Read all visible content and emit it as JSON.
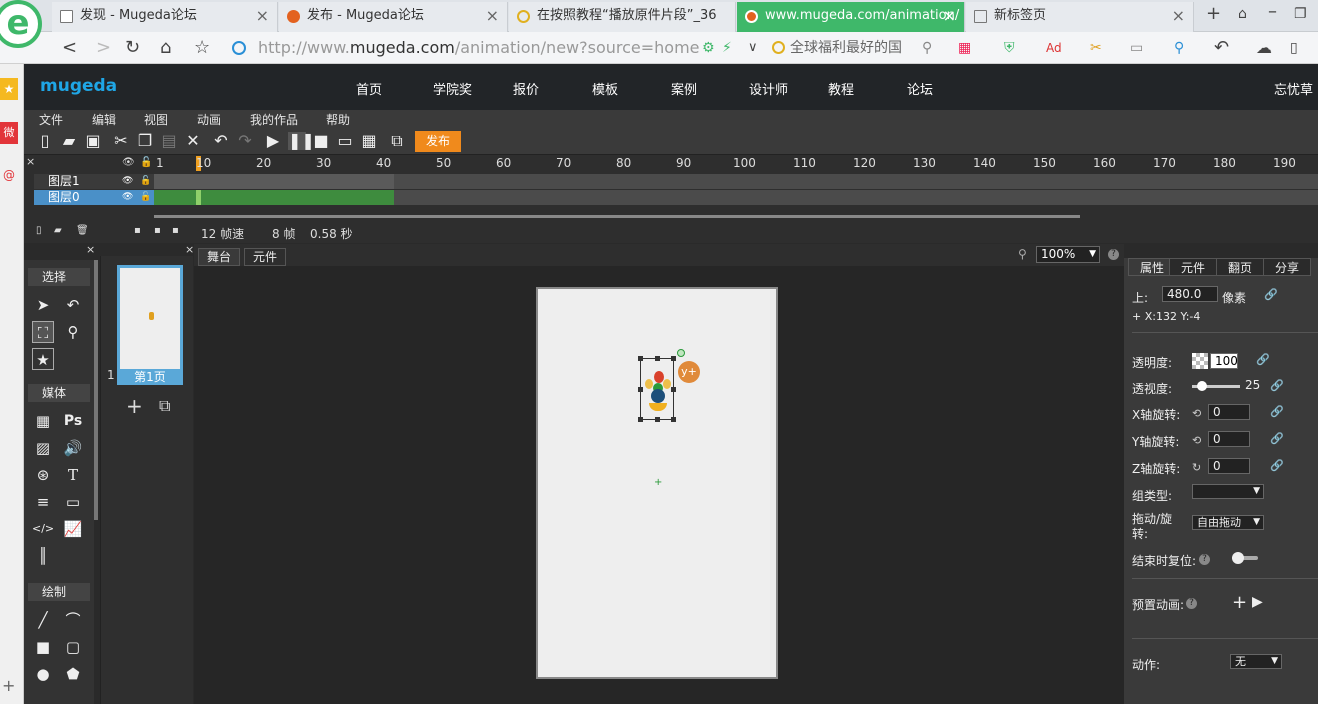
{
  "browser": {
    "tabs": [
      {
        "label": "发现 - Mugeda论坛",
        "active": false,
        "favicon_color": "#ffffff"
      },
      {
        "label": "发布 - Mugeda论坛",
        "active": false,
        "favicon_color": "#e3621f"
      },
      {
        "label": "在按照教程“播放原件片段”_36",
        "active": false,
        "favicon_color": "#e0b020"
      },
      {
        "label": "www.mugeda.com/animation/",
        "active": true,
        "favicon_color": "#e3621f"
      },
      {
        "label": "新标签页",
        "active": false,
        "favicon_color": "#777777"
      }
    ],
    "url_prefix": "http://www.",
    "url_host": "mugeda.com",
    "url_path": "/animation/new?source=home",
    "search_text": "全球福利最好的国",
    "accent": "#3fb86a"
  },
  "app": {
    "logo": "mugeda",
    "nav": [
      "首页",
      "学院奖",
      "报价",
      "模板",
      "案例",
      "设计师",
      "教程",
      "论坛"
    ],
    "user": "忘忧草",
    "menu": [
      "文件",
      "编辑",
      "视图",
      "动画",
      "我的作品",
      "帮助"
    ],
    "publish_label": "发布"
  },
  "timeline": {
    "ruler": [
      "1",
      "10",
      "20",
      "30",
      "40",
      "50",
      "60",
      "70",
      "80",
      "90",
      "100",
      "110",
      "120",
      "130",
      "140",
      "150",
      "160",
      "170",
      "180",
      "190"
    ],
    "layers": [
      {
        "name": "图层1",
        "selected": false
      },
      {
        "name": "图层0",
        "selected": true
      }
    ],
    "status": {
      "fps": "12 帧速",
      "frame": "8 帧",
      "time": "0.58 秒"
    }
  },
  "tools": {
    "sections": [
      "选择",
      "媒体",
      "绘制"
    ]
  },
  "pages": {
    "page_num": "1",
    "page_label": "第1页"
  },
  "stage": {
    "tabs": [
      "舞台",
      "元件"
    ],
    "zoom": "100%"
  },
  "properties": {
    "tabs": [
      "属性",
      "元件",
      "翻页",
      "分享"
    ],
    "top_label": "上:",
    "top_value": "480.0",
    "top_unit": "像素",
    "coords": "X:132  Y:-4",
    "opacity_label": "透明度:",
    "opacity_value": "100",
    "perspective_label": "透视度:",
    "perspective_value": "25",
    "perspective_level": 0.2,
    "xrot_label": "X轴旋转:",
    "xrot_value": "0",
    "yrot_label": "Y轴旋转:",
    "yrot_value": "0",
    "zrot_label": "Z轴旋转:",
    "zrot_value": "0",
    "group_label": "组类型:",
    "group_value": "",
    "drag_label": "拖动/旋转:",
    "drag_value": "自由拖动",
    "reset_label": "结束时复位:",
    "preset_label": "预置动画:",
    "action_label": "动作:",
    "action_value": "无"
  }
}
